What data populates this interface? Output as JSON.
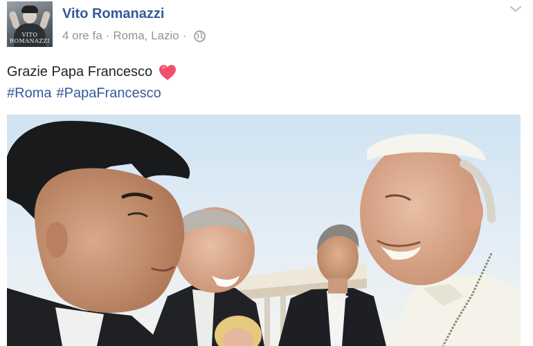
{
  "post": {
    "author": "Vito Romanazzi",
    "avatar_signature": "VITO ROMANAZZI",
    "time": "4 ore fa",
    "location": "Roma, Lazio",
    "separator": "·",
    "privacy_icon": "globe-icon",
    "menu_icon": "chevron-down-icon",
    "text": "Grazie Papa Francesco",
    "emoji_icon": "heart-icon",
    "hashtags": [
      "#Roma",
      "#PapaFrancesco"
    ]
  },
  "colors": {
    "link": "#365899",
    "meta": "#90949c",
    "text": "#1d2129",
    "heart": "#f0506e"
  }
}
